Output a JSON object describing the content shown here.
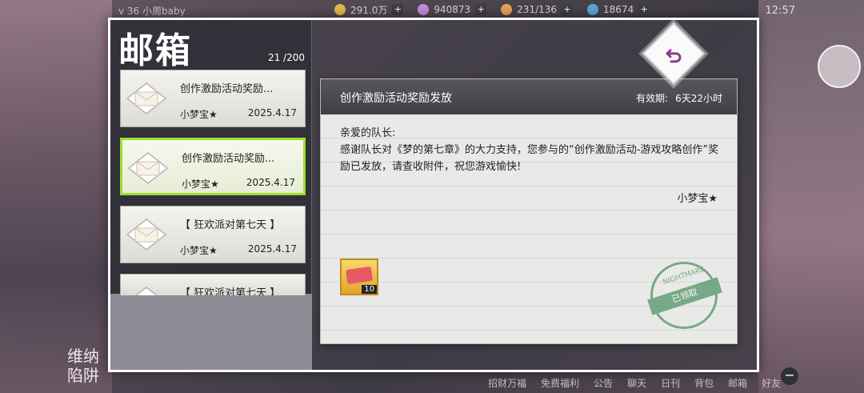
{
  "topbar": {
    "level": "v 36  小周baby",
    "gold": "291.0万",
    "gems": "940873",
    "stamina": "231/136",
    "tickets": "18674",
    "time": "12:57"
  },
  "mailbox": {
    "title": "邮箱",
    "count": "21  /200"
  },
  "mails": [
    {
      "subject": "创作激励活动奖励...",
      "sender": "小梦宝★",
      "date": "2025.4.17",
      "selected": false
    },
    {
      "subject": "创作激励活动奖励...",
      "sender": "小梦宝★",
      "date": "2025.4.17",
      "selected": true
    },
    {
      "subject": "【 狂欢派对第七天 】",
      "sender": "小梦宝★",
      "date": "2025.4.17",
      "selected": false
    },
    {
      "subject": "【 狂欢派对第七天 】",
      "sender": "",
      "date": "",
      "selected": false
    }
  ],
  "letter": {
    "subject": "创作激励活动奖励发放",
    "expiry_label": "有效期:",
    "expiry_value": "6天22小时",
    "greeting": "亲爱的队长:",
    "body": "感谢队长对《梦的第七章》的大力支持，您参与的“创作激励活动-游戏攻略创作”奖励已发放，请查收附件，祝您游戏愉快!",
    "signature": "小梦宝★",
    "attachment_qty": "10",
    "stamp_text": "已领取",
    "stamp_top": "NIGHTMARE"
  },
  "bottom_nav": [
    "招财万福",
    "免费福利",
    "公告",
    "聊天",
    "日刊",
    "背包",
    "邮箱",
    "好友"
  ],
  "left_banner": "维纳\n陷阱",
  "colors": {
    "selected_border": "#9be02e",
    "stamp": "#5a9a6e"
  }
}
